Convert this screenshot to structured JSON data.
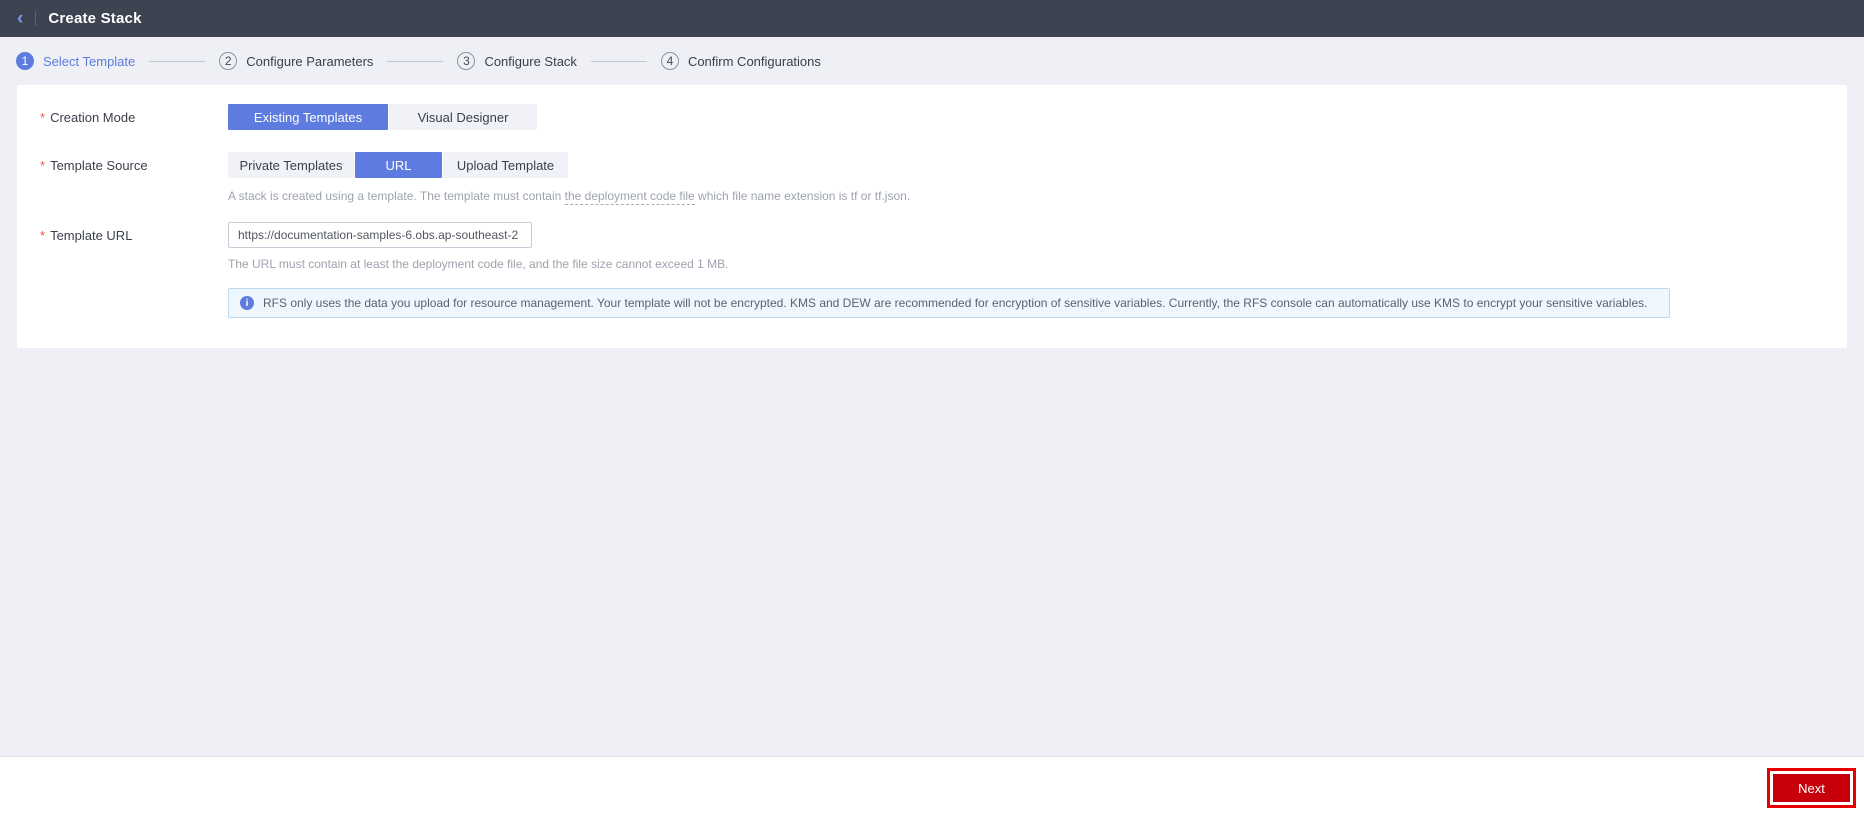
{
  "header": {
    "back_icon": "‹",
    "title": "Create Stack"
  },
  "steps": {
    "items": [
      {
        "num": "1",
        "label": "Select Template",
        "active": true
      },
      {
        "num": "2",
        "label": "Configure Parameters",
        "active": false
      },
      {
        "num": "3",
        "label": "Configure Stack",
        "active": false
      },
      {
        "num": "4",
        "label": "Confirm Configurations",
        "active": false
      }
    ]
  },
  "form": {
    "creation_mode": {
      "required": "*",
      "label": "Creation Mode",
      "options": [
        {
          "label": "Existing Templates",
          "selected": true
        },
        {
          "label": "Visual Designer",
          "selected": false
        }
      ]
    },
    "template_source": {
      "required": "*",
      "label": "Template Source",
      "options": [
        {
          "label": "Private Templates",
          "selected": false
        },
        {
          "label": "URL",
          "selected": true
        },
        {
          "label": "Upload Template",
          "selected": false
        }
      ],
      "hint_before": "A stack is created using a template. The template must contain ",
      "hint_link": "the deployment code file",
      "hint_after": " which file name extension is tf or tf.json."
    },
    "template_url": {
      "required": "*",
      "label": "Template URL",
      "value": "https://documentation-samples-6.obs.ap-southeast-2",
      "hint": "The URL must contain at least the deployment code file, and the file size cannot exceed 1 MB."
    },
    "notice": {
      "icon": "i",
      "text": "RFS only uses the data you upload for resource management. Your template will not be encrypted. KMS and DEW are recommended for encryption of sensitive variables. Currently, the RFS console can automatically use KMS to encrypt your sensitive variables."
    }
  },
  "footer": {
    "next_label": "Next"
  },
  "colors": {
    "accent_blue": "#5e7ce0",
    "header_bg": "#3e4352",
    "page_bg": "#eef0f5",
    "primary_button_red": "#c7000b",
    "annotation_red": "#e60000",
    "notice_bg": "#eff7fe",
    "notice_border": "#bcd9f2"
  }
}
